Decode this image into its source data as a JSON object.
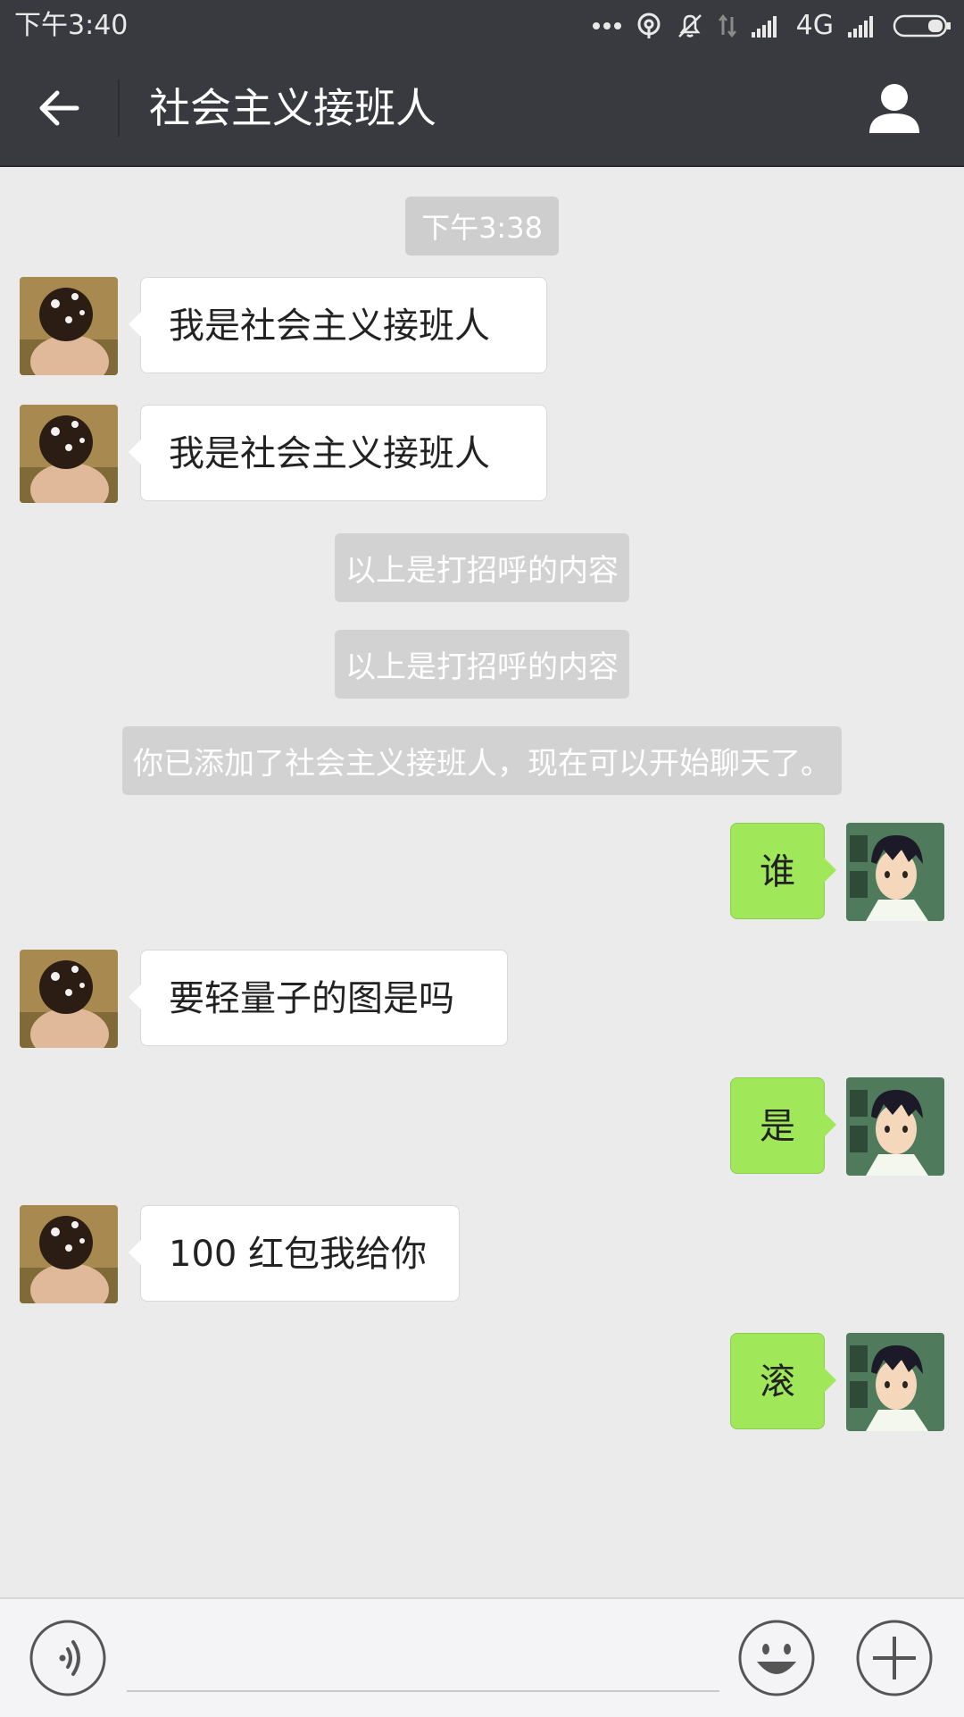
{
  "status_bar": {
    "time": "下午3:40",
    "network": "4G",
    "icons": [
      "more-dots-icon",
      "hotspot-icon",
      "mute-bell-icon",
      "data-arrows-icon",
      "signal-icon",
      "signal-icon",
      "battery-icon"
    ]
  },
  "header": {
    "title": "社会主义接班人",
    "back_icon": "arrow-left-icon",
    "profile_icon": "person-icon"
  },
  "chat": {
    "timestamp": "下午3:38",
    "messages": [
      {
        "side": "left",
        "text": "我是社会主义接班人"
      },
      {
        "side": "left",
        "text": "我是社会主义接班人"
      },
      {
        "side": "system",
        "text": "以上是打招呼的内容"
      },
      {
        "side": "system",
        "text": "以上是打招呼的内容"
      },
      {
        "side": "system",
        "text": "你已添加了社会主义接班人，现在可以开始聊天了。"
      },
      {
        "side": "right",
        "text": "谁"
      },
      {
        "side": "left",
        "text": "要轻量子的图是吗"
      },
      {
        "side": "right",
        "text": "是"
      },
      {
        "side": "left",
        "text": "100 红包我给你"
      },
      {
        "side": "right",
        "text": "滚"
      }
    ]
  },
  "input_bar": {
    "voice_icon": "voice-icon",
    "emoji_icon": "emoji-icon",
    "plus_icon": "plus-icon",
    "input_value": ""
  },
  "colors": {
    "header_bg": "#393a3f",
    "chat_bg": "#ebebeb",
    "sent_bubble": "#a0e75a",
    "received_bubble": "#ffffff"
  }
}
